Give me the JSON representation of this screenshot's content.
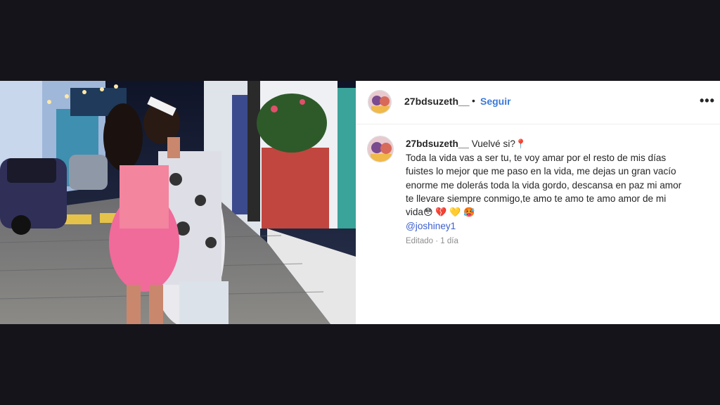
{
  "header": {
    "username": "27bdsuzeth__",
    "separator": "•",
    "follow_label": "Seguir",
    "more_icon": "more-horizontal-icon"
  },
  "caption": {
    "username": "27bdsuzeth__",
    "line1": "Vuelvé si?",
    "line1_emoji": "📍",
    "line2": "Toda la vida vas a ser tu, te voy amar por el resto de mis días",
    "line3": "fuistes lo mejor que me paso en la vida, me dejas un gran vacío",
    "line4": "enorme me dolerás toda la vida gordo, descansa en paz mi amor",
    "line5": "te llevare siempre conmigo,te amo te amo te amo amor de mi",
    "line6": "vida",
    "line6_emojis": [
      "😳",
      "💔",
      "💛",
      "🥵"
    ],
    "mention": "@joshiney1"
  },
  "meta": {
    "edited": "Editado",
    "separator": "·",
    "time": "1 día"
  },
  "photo": {
    "next_icon": "chevron-right-icon"
  },
  "colors": {
    "follow": "#3b7ad8",
    "mention": "#3b5ed0",
    "text": "#262626",
    "muted": "#8e8e8e",
    "backdrop": "#15141a"
  }
}
